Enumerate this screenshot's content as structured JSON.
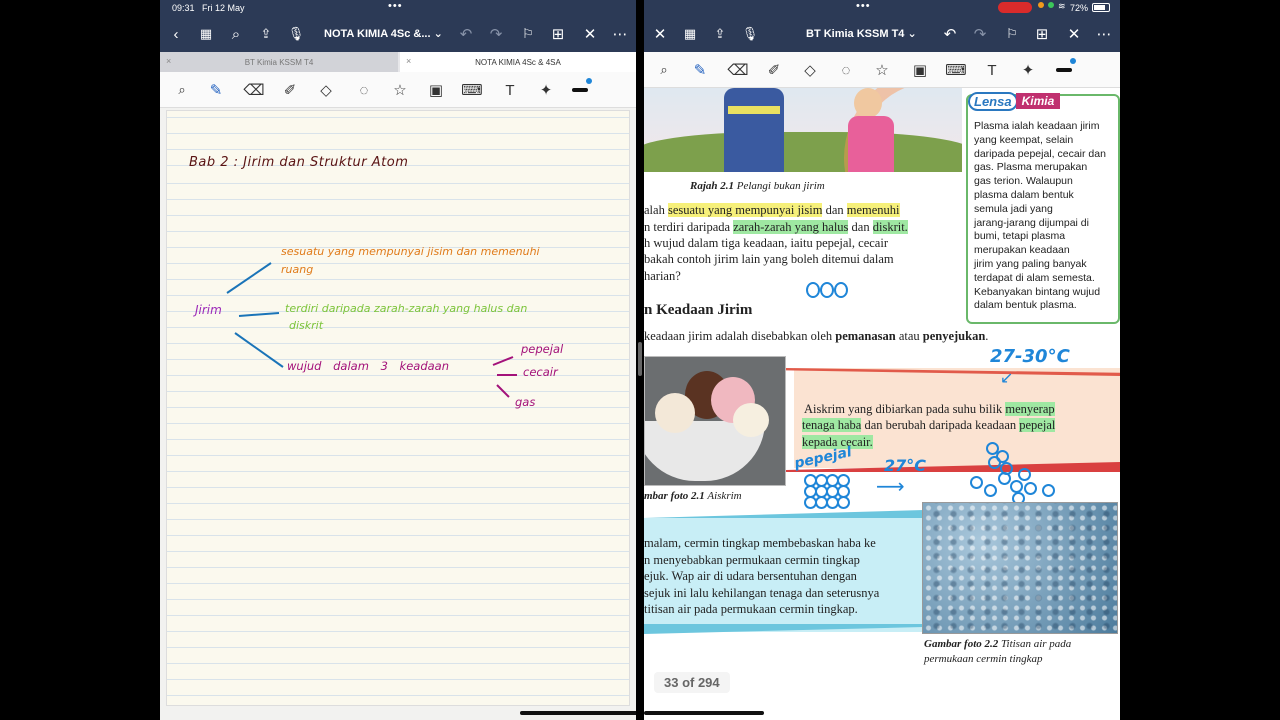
{
  "left": {
    "status": {
      "time": "09:31",
      "date": "Fri 12 May"
    },
    "nav": {
      "title": "NOTA KIMIA 4Sc &...",
      "title_caret": "⌄"
    },
    "tabs": [
      {
        "label": "BT Kimia KSSM T4",
        "close": "×"
      },
      {
        "label": "NOTA KIMIA 4Sc & 4SA",
        "close": "×"
      }
    ],
    "notes": {
      "title": "Bab 2 : Jirim dan Struktur Atom",
      "jirim": "Jirim",
      "def1_l1": "sesuatu yang mempunyai jisim dan memenuhi",
      "def1_l2": "ruang",
      "def2_l1": "terdiri daripada zarah-zarah yang halus dan",
      "def2_l2": "diskrit",
      "def3": "wujud dalam 3 keadaan",
      "state1": "pepejal",
      "state2": "cecair",
      "state3": "gas"
    }
  },
  "right": {
    "status": {
      "battery": "72%"
    },
    "nav": {
      "title": "BT Kimia KSSM T4",
      "title_caret": "⌄"
    },
    "pdf": {
      "caption_rajah_num": "Rajah 2.1",
      "caption_rajah": "Pelangi bukan jirim",
      "p1_a": "alah ",
      "p1_b": "sesuatu yang mempunyai jisim",
      "p1_c": " dan ",
      "p1_d": "memenuhi",
      "p2_a": "n terdiri daripada ",
      "p2_b": "zarah-zarah yang halus",
      "p2_c": " dan ",
      "p2_d": "diskrit.",
      "p3": "h wujud dalam tiga keadaan, iaitu pepejal, cecair",
      "p4": "bakah contoh jirim lain yang boleh ditemui dalam",
      "p5": "harian?",
      "heading": "n Keadaan Jirim",
      "p6_a": "keadaan jirim adalah disebabkan oleh ",
      "p6_b": "pemanasan",
      "p6_c": " atau ",
      "p6_d": "penyejukan",
      "p6_e": ".",
      "lensa": "Lensa",
      "kimia": "Kimia",
      "lensa_lines": [
        "Plasma ialah keadaan jirim",
        "yang keempat, selain",
        "daripada pepejal, cecair dan",
        "gas. Plasma merupakan",
        "gas terion. Walaupun",
        "plasma dalam bentuk",
        "semula jadi yang",
        "jarang-jarang dijumpai di",
        "bumi, tetapi plasma",
        "merupakan keadaan",
        "jirim yang paling banyak",
        "terdapat di alam semesta.",
        "Kebanyakan bintang wujud",
        "dalam bentuk plasma."
      ],
      "ais_l1_a": "Aiskrim yang dibiarkan pada suhu bilik ",
      "ais_l1_b": "menyerap",
      "ais_l2_a": "tenaga haba",
      "ais_l2_b": " dan berubah daripada keadaan ",
      "ais_l2_c": "pepejal",
      "ais_l3": "kepada cecair.",
      "foto1_num": "mbar foto 2.1",
      "foto1": "Aiskrim",
      "p7": "malam, cermin tingkap membebaskan haba ke",
      "p8": "n menyebabkan permukaan cermin tingkap",
      "p9": "ejuk. Wap air di udara bersentuhan dengan",
      "p10": "sejuk ini lalu kehilangan tenaga dan seterusnya",
      "p11": "titisan air pada permukaan cermin tingkap.",
      "foto2_num": "Gambar foto 2.2",
      "foto2_a": "Titisan air pada",
      "foto2_b": "permukaan cermin tingkap",
      "ann_temp1": "27-30°C",
      "ann_temp2": "27°C",
      "ann_pepejal": "pepejal",
      "page_indicator": "33 of 294"
    }
  },
  "colors": {
    "navbar": "#2c3a56",
    "ink_dark": "#5a1414",
    "ink_orange": "#e07b1a",
    "ink_green": "#7cc43a",
    "ink_purple": "#9c2ab8",
    "ink_magenta": "#a3127a",
    "ink_blue": "#1f86d8"
  }
}
